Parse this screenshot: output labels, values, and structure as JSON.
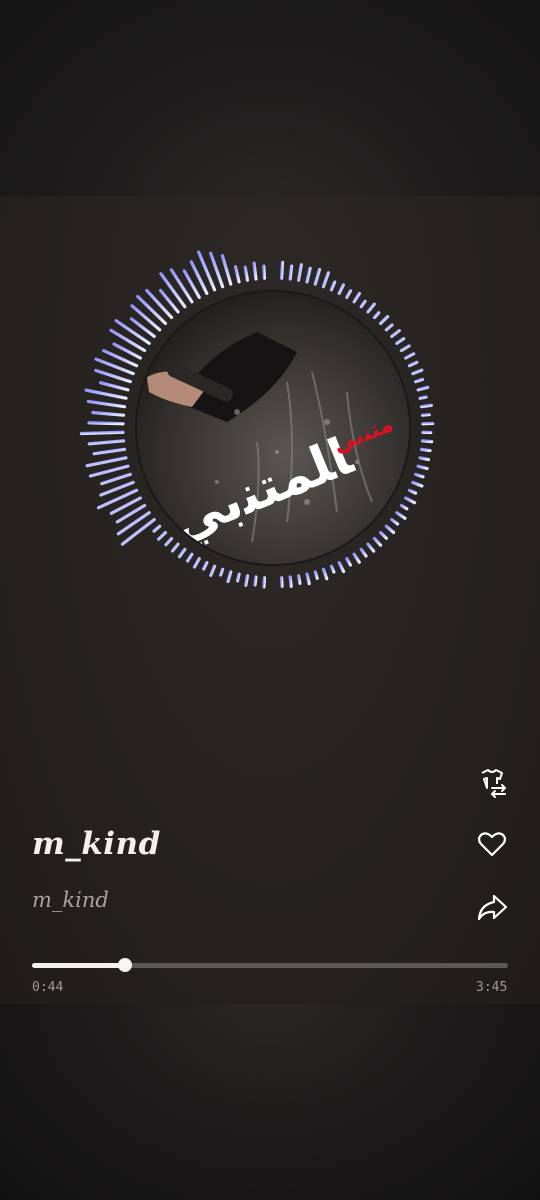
{
  "track": {
    "title": "m_kind",
    "artist": "m_kind",
    "elapsed": "0:44",
    "duration": "3:45",
    "progress": 0.195
  },
  "cover": {
    "overlay_text": "ﺎﻠﻤﺘﻨﺑﻲ",
    "accent_text": "ﻣﺘﻨﺑﻲ"
  },
  "actions": [
    {
      "name": "switch-cover-icon"
    },
    {
      "name": "heart-icon"
    },
    {
      "name": "share-icon"
    }
  ],
  "colors": {
    "visualizer_start": "#8f95ff",
    "visualizer_end": "#dfe6ff",
    "progress_fill": "#f2efec",
    "progress_track": "#5c5855"
  }
}
